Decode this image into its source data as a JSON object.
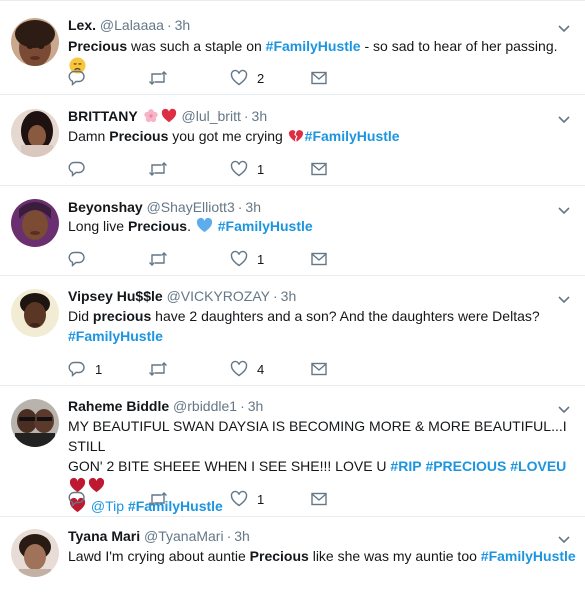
{
  "tweets": [
    {
      "name": "Lex.",
      "handle": "@Lalaaaa",
      "time": "3h",
      "text_parts": [
        {
          "t": "Precious",
          "s": "b"
        },
        {
          "t": " was such a staple on ",
          "s": ""
        },
        {
          "t": "#FamilyHustle",
          "s": "tag"
        },
        {
          "t": " - so sad to hear of her passing. ",
          "s": ""
        }
      ],
      "trailing_emoji": "disappointed-face-emoji",
      "replies": "",
      "retweets": "",
      "likes": "2"
    },
    {
      "name": "BRITTANY",
      "name_emojis": [
        "cherry-blossom-emoji",
        "red-heart-emoji"
      ],
      "handle": "@lul_britt",
      "time": "3h",
      "text_parts": [
        {
          "t": "Damn ",
          "s": ""
        },
        {
          "t": "Precious",
          "s": "b"
        },
        {
          "t": " you got me crying ",
          "s": ""
        },
        {
          "t": "#FamilyHustle",
          "s": "tag"
        }
      ],
      "inline_emoji": "broken-heart-emoji",
      "replies": "",
      "retweets": "",
      "likes": "1"
    },
    {
      "name": "Beyonshay",
      "handle": "@ShayElliott3",
      "time": "3h",
      "text_parts": [
        {
          "t": "Long live ",
          "s": ""
        },
        {
          "t": "Precious",
          "s": "b"
        },
        {
          "t": ". ",
          "s": ""
        },
        {
          "t": " #FamilyHustle",
          "s": "tag"
        }
      ],
      "inline_emoji": "blue-heart-emoji",
      "replies": "",
      "retweets": "",
      "likes": "1"
    },
    {
      "name": "Vipsey Hu$$le",
      "handle": "@VICKYROZAY",
      "time": "3h",
      "text_line1": [
        {
          "t": "Did ",
          "s": ""
        },
        {
          "t": "precious",
          "s": "b"
        },
        {
          "t": " have 2 daughters and a son? And the daughters were Deltas?",
          "s": ""
        }
      ],
      "text_line2": [
        {
          "t": "#FamilyHustle",
          "s": "tag"
        }
      ],
      "replies": "1",
      "retweets": "",
      "likes": "4"
    },
    {
      "name": "Raheme Biddle",
      "handle": "@rbiddle1",
      "time": "3h",
      "text_line1": [
        {
          "t": "MY BEAUTIFUL SWAN DAYSIA IS BECOMING MORE & MORE BEAUTIFUL...I STILL",
          "s": ""
        }
      ],
      "text_line2": [
        {
          "t": "GON' 2 BITE SHEEE WHEN I SEE SHE!!! LOVE U ",
          "s": ""
        },
        {
          "t": "#RIP",
          "s": "tag"
        },
        {
          "t": " ",
          "s": ""
        },
        {
          "t": "#PRECIOUS",
          "s": "tag"
        },
        {
          "t": " ",
          "s": ""
        },
        {
          "t": "#LOVEU",
          "s": "tag"
        }
      ],
      "text_line3": [
        {
          "t": "@Tip",
          "s": "mention"
        },
        {
          "t": " ",
          "s": ""
        },
        {
          "t": "#FamilyHustle",
          "s": "tag"
        }
      ],
      "replies": "",
      "retweets": "",
      "likes": "1"
    },
    {
      "name": "Tyana Mari",
      "handle": "@TyanaMari",
      "time": "3h",
      "text_parts": [
        {
          "t": "Lawd I'm crying about auntie ",
          "s": ""
        },
        {
          "t": "Precious",
          "s": "b"
        },
        {
          "t": " like she was my auntie too ",
          "s": ""
        },
        {
          "t": "#FamilyHustle",
          "s": "tag"
        }
      ]
    }
  ],
  "colors": {
    "link": "#1b95e0",
    "secondary_text": "#657786",
    "icon": "#657786",
    "divider": "#e6ecf0",
    "heart_red": "#be1931"
  }
}
